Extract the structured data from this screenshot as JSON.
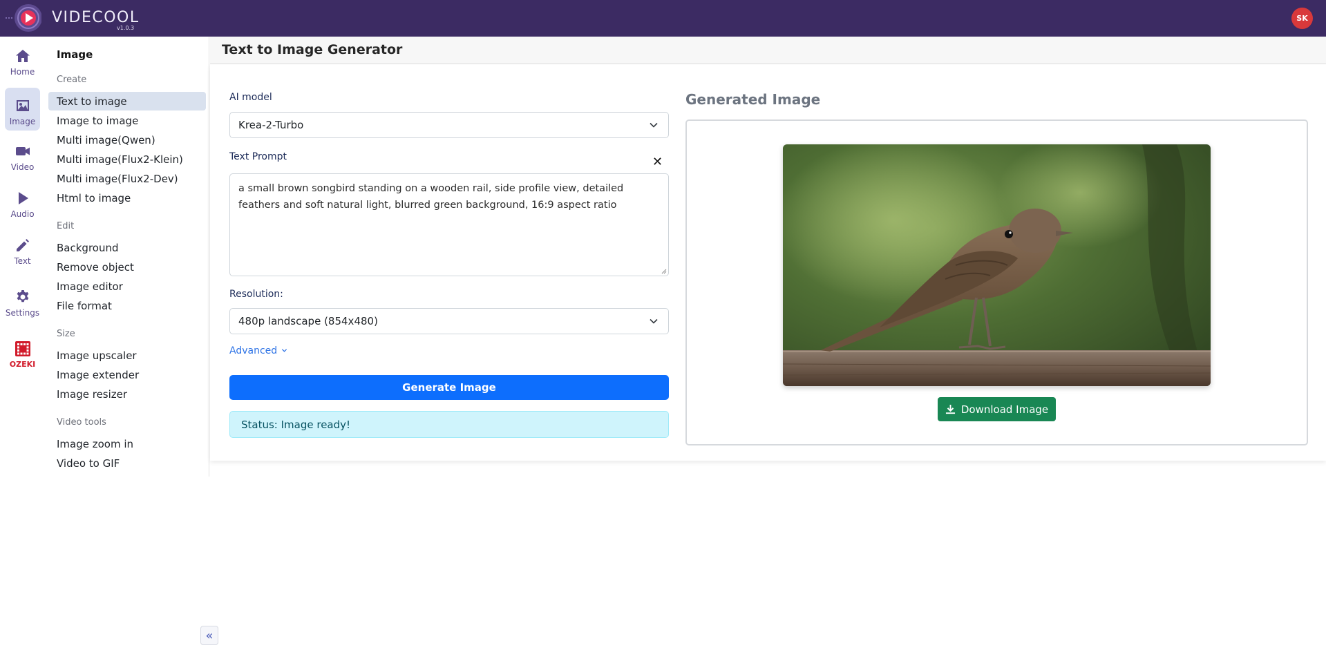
{
  "app": {
    "brand": "VIDECOOL",
    "version": "v1.0.3",
    "user_initials": "SK"
  },
  "rail": [
    {
      "label": "Home",
      "icon": "home-icon"
    },
    {
      "label": "Image",
      "icon": "image-icon",
      "active": true
    },
    {
      "label": "Video",
      "icon": "video-icon"
    },
    {
      "label": "Audio",
      "icon": "play-icon"
    },
    {
      "label": "Text",
      "icon": "pencil-icon"
    },
    {
      "label": "Settings",
      "icon": "gear-icon"
    },
    {
      "label": "OZEKI",
      "icon": "ozeki-logo-icon"
    }
  ],
  "menu": {
    "title": "Image",
    "sections": {
      "create": "Create",
      "edit": "Edit",
      "size": "Size",
      "video_tools": "Video tools"
    },
    "items": {
      "text_to_image": "Text to image",
      "image_to_image": "Image to image",
      "multi_qwen": "Multi image(Qwen)",
      "multi_flux2_klein": "Multi image(Flux2-Klein)",
      "multi_flux2_dev": "Multi image(Flux2-Dev)",
      "html_to_image": "Html to image",
      "background": "Background",
      "remove_object": "Remove object",
      "image_editor": "Image editor",
      "file_format": "File format",
      "image_upscaler": "Image upscaler",
      "image_extender": "Image extender",
      "image_resizer": "Image resizer",
      "image_zoom_in": "Image zoom in",
      "video_to_gif": "Video to GIF"
    },
    "collapse_glyph": "«"
  },
  "page": {
    "title": "Text to Image Generator",
    "ai_model_label": "AI model",
    "ai_model_value": "Krea-2-Turbo",
    "prompt_label": "Text Prompt",
    "prompt_clear_glyph": "✕",
    "prompt_value": "a small brown songbird standing on a wooden rail, side profile view, detailed feathers and soft natural light, blurred green background, 16:9 aspect ratio",
    "resolution_label": "Resolution:",
    "resolution_value": "480p landscape (854x480)",
    "advanced_label": "Advanced",
    "generate_label": "Generate Image",
    "status_text": "Status: Image ready!",
    "generated_heading": "Generated Image",
    "download_label": "Download Image"
  },
  "colors": {
    "topbar": "#3c2b63",
    "primary": "#0d6efd",
    "success": "#198754",
    "status_bg": "#cff4fc",
    "avatar": "#d9393b",
    "rail_accent": "#5b4c8c",
    "ozeki": "#d11a2a"
  }
}
